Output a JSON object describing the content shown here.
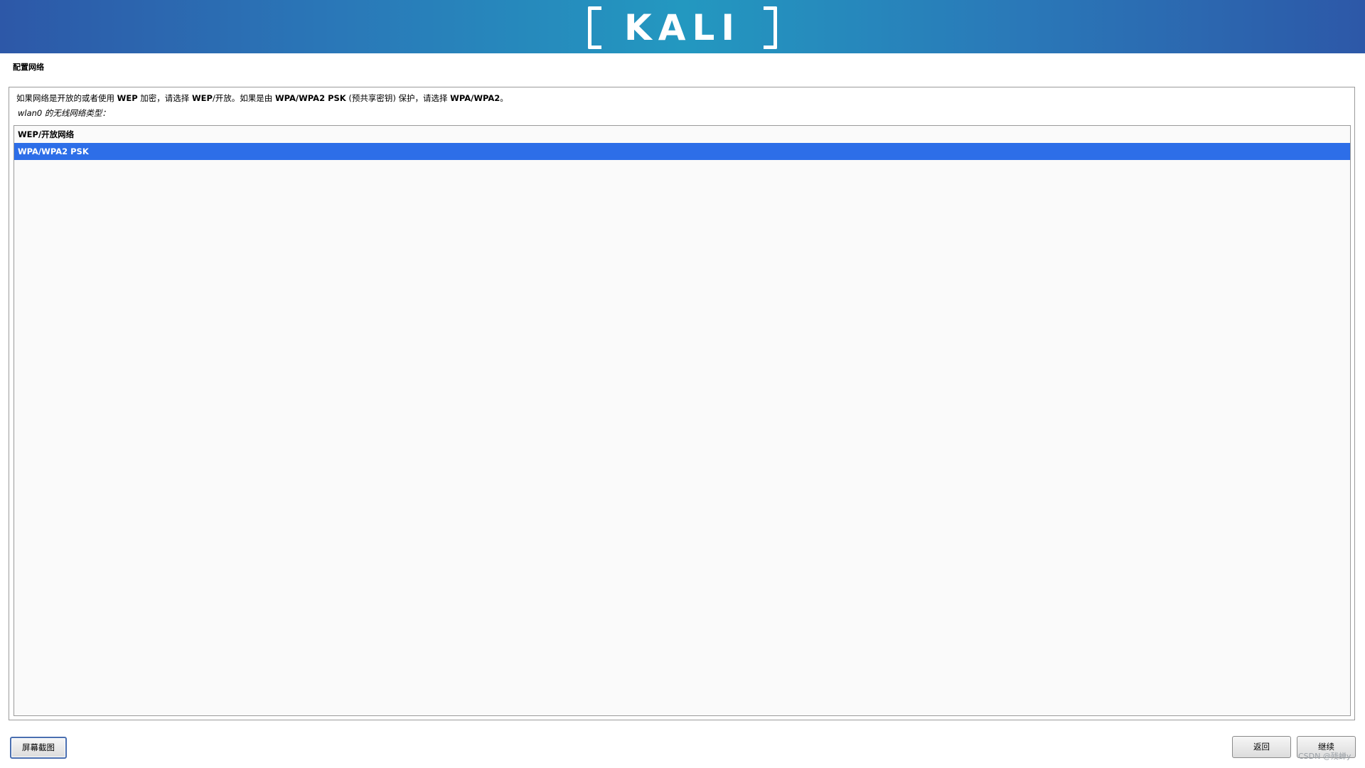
{
  "banner": {
    "logo_text": "KALI",
    "colors": {
      "edge": "#2d58a8",
      "center": "#2398c0"
    }
  },
  "page": {
    "title": "配置网络"
  },
  "panel": {
    "description": {
      "p1": "如果网络是开放的或者使用 ",
      "b1": "WEP",
      "p2": " 加密，请选择 ",
      "b2": "WEP",
      "p3": "/开放。如果是由 ",
      "b3": "WPA/WPA2 PSK",
      "p4": " (预共享密钥) 保护，请选择 ",
      "b4": "WPA/WPA2",
      "p5": "。"
    },
    "question": "wlan0 的无线网络类型："
  },
  "list": {
    "items": [
      {
        "label": "WEP/开放网络",
        "selected": false
      },
      {
        "label": "WPA/WPA2 PSK",
        "selected": true
      }
    ],
    "selection_color": "#2d6ee8"
  },
  "buttons": {
    "screenshot_label": "屏幕截图",
    "back_label": "返回",
    "continue_label": "继续"
  },
  "watermark": "CSDN @残蝉y"
}
